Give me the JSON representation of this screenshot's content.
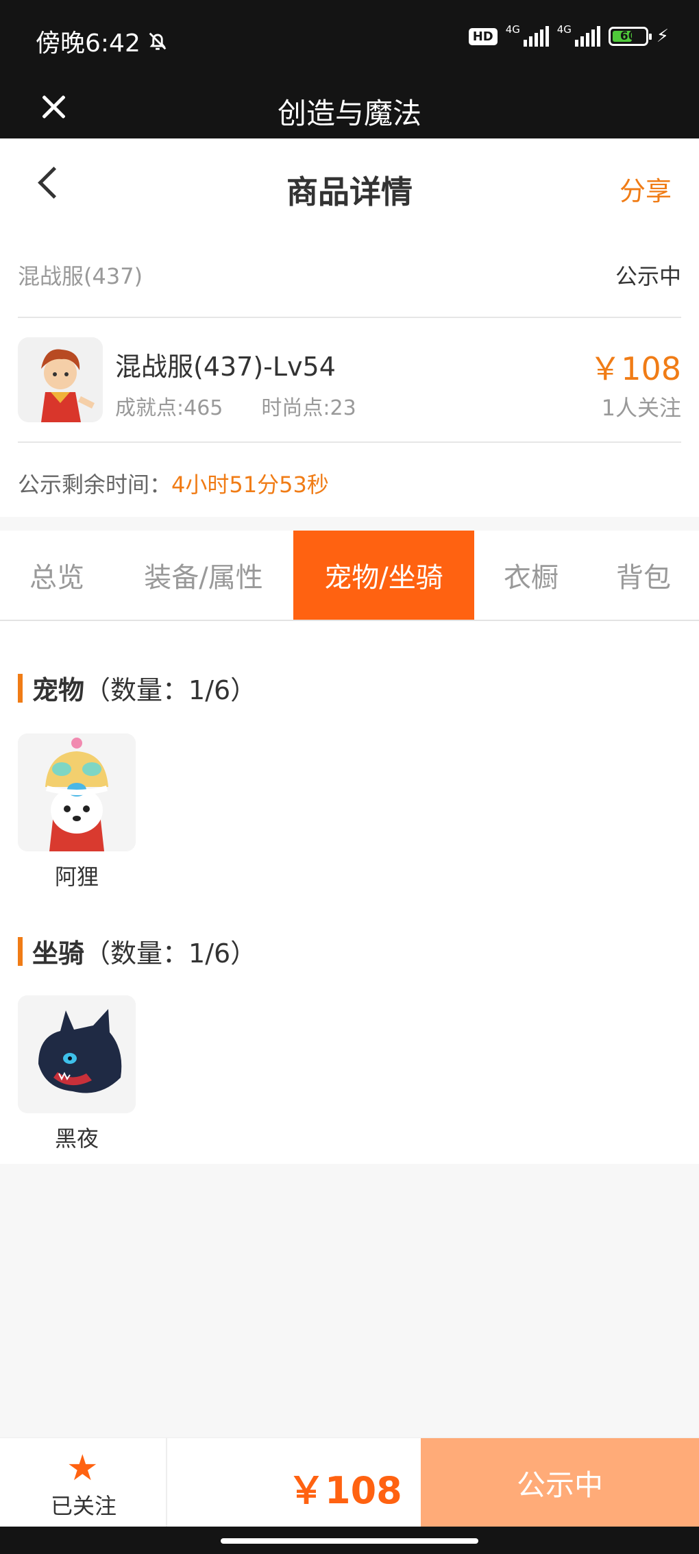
{
  "status_bar": {
    "time": "傍晚6:42",
    "hd_label": "HD",
    "network_1": "4G",
    "network_2": "4G",
    "battery": "60"
  },
  "app_bar": {
    "title": "创造与魔法"
  },
  "header": {
    "title": "商品详情",
    "share_label": "分享"
  },
  "item": {
    "server": "混战服(437)",
    "state": "公示中",
    "title": "混战服(437)-Lv54",
    "achievement": "成就点:465",
    "fashion": "时尚点:23",
    "price": "￥108",
    "followers": "1人关注",
    "countdown_label": "公示剩余时间：",
    "countdown_value": "4小时51分53秒"
  },
  "tabs": [
    {
      "label": "总览"
    },
    {
      "label": "装备/属性"
    },
    {
      "label": "宠物/坐骑",
      "active": true
    },
    {
      "label": "衣橱"
    },
    {
      "label": "背包"
    }
  ],
  "pets": {
    "title": "宠物",
    "count": "（数量：1/6）",
    "items": [
      {
        "name": "阿狸"
      }
    ]
  },
  "mounts": {
    "title": "坐骑",
    "count": "（数量：1/6）",
    "items": [
      {
        "name": "黑夜"
      }
    ]
  },
  "bottom_bar": {
    "follow_label": "已关注",
    "price": "￥108",
    "state_label": "公示中"
  },
  "colors": {
    "accent": "#ff6211",
    "price": "#f07c16",
    "state_button": "#ffab78"
  }
}
